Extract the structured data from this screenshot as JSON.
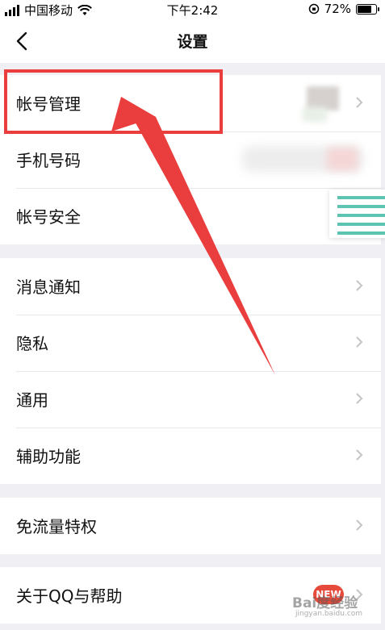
{
  "status_bar": {
    "carrier": "中国移动",
    "time": "下午2:42",
    "battery_percent": "72%",
    "battery_level": 0.72
  },
  "nav": {
    "title": "设置",
    "back_icon": "chevron-left-icon"
  },
  "groups": [
    {
      "items": [
        {
          "label": "帐号管理"
        },
        {
          "label": "手机号码"
        },
        {
          "label": "帐号安全"
        }
      ]
    },
    {
      "items": [
        {
          "label": "消息通知"
        },
        {
          "label": "隐私"
        },
        {
          "label": "通用"
        },
        {
          "label": "辅助功能"
        }
      ]
    },
    {
      "items": [
        {
          "label": "免流量特权"
        }
      ]
    },
    {
      "items": [
        {
          "label": "关于QQ与帮助"
        }
      ]
    }
  ],
  "badge": {
    "text": "NEW"
  },
  "annotation": {
    "color": "#ea3d3d"
  },
  "watermark": {
    "text": "Bai度经验",
    "sub": "jingyan.baidu.com"
  },
  "colors": {
    "background": "#f0f0f4",
    "row": "#ffffff",
    "chevron": "#c4c4c8",
    "accent_red": "#ea3d3d"
  }
}
